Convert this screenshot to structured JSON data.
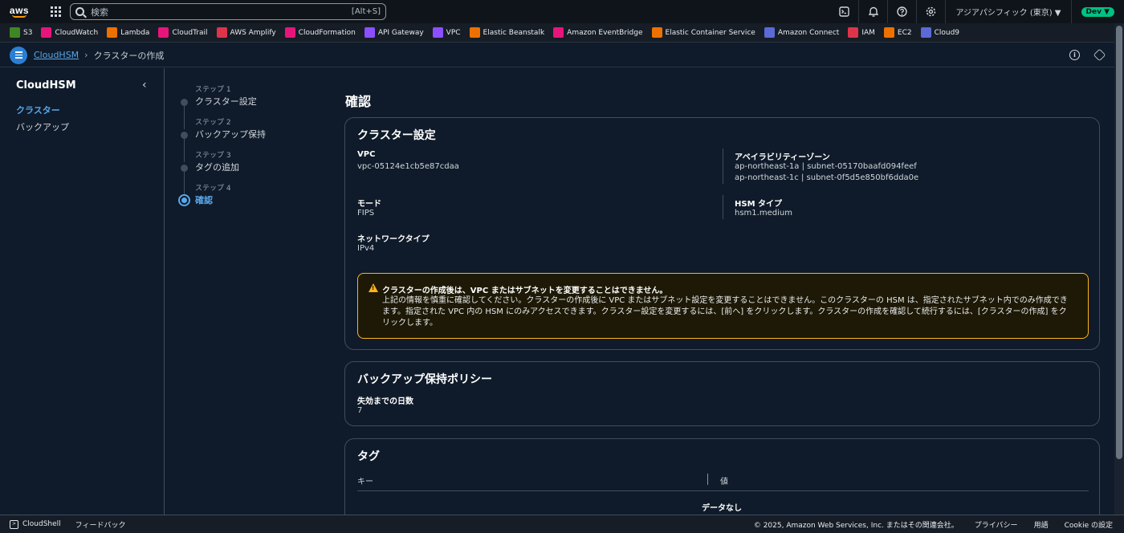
{
  "topnav": {
    "logo_text": "aws",
    "search_placeholder": "検索",
    "search_shortcut": "[Alt+S]",
    "region": "アジアパシフィック (東京) ▼",
    "account_badge": "Dev ▼"
  },
  "favorites": [
    {
      "label": "S3",
      "color": "#3f8624",
      "icon": "s3-icon"
    },
    {
      "label": "CloudWatch",
      "color": "#e7157b",
      "icon": "cloudwatch-icon"
    },
    {
      "label": "Lambda",
      "color": "#ed7100",
      "icon": "lambda-icon"
    },
    {
      "label": "CloudTrail",
      "color": "#e7157b",
      "icon": "cloudtrail-icon"
    },
    {
      "label": "AWS Amplify",
      "color": "#dd344c",
      "icon": "amplify-icon"
    },
    {
      "label": "CloudFormation",
      "color": "#e7157b",
      "icon": "cloudformation-icon"
    },
    {
      "label": "API Gateway",
      "color": "#8c4fff",
      "icon": "api-gateway-icon"
    },
    {
      "label": "VPC",
      "color": "#8c4fff",
      "icon": "vpc-icon"
    },
    {
      "label": "Elastic Beanstalk",
      "color": "#ed7100",
      "icon": "beanstalk-icon"
    },
    {
      "label": "Amazon EventBridge",
      "color": "#e7157b",
      "icon": "eventbridge-icon"
    },
    {
      "label": "Elastic Container Service",
      "color": "#ed7100",
      "icon": "ecs-icon"
    },
    {
      "label": "Amazon Connect",
      "color": "#5a6ad6",
      "icon": "connect-icon"
    },
    {
      "label": "IAM",
      "color": "#dd344c",
      "icon": "iam-icon"
    },
    {
      "label": "EC2",
      "color": "#ed7100",
      "icon": "ec2-icon"
    },
    {
      "label": "Cloud9",
      "color": "#5a6ad6",
      "icon": "cloud9-icon"
    }
  ],
  "breadcrumb": {
    "root": "CloudHSM",
    "current": "クラスターの作成"
  },
  "sidebar": {
    "title": "CloudHSM",
    "items": [
      {
        "label": "クラスター",
        "active": true
      },
      {
        "label": "バックアップ",
        "active": false
      }
    ]
  },
  "steps": [
    {
      "label": "ステップ 1",
      "name": "クラスター設定"
    },
    {
      "label": "ステップ 2",
      "name": "バックアップ保持"
    },
    {
      "label": "ステップ 3",
      "name": "タグの追加"
    },
    {
      "label": "ステップ 4",
      "name": "確認"
    }
  ],
  "page_title": "確認",
  "cluster": {
    "title": "クラスター設定",
    "vpc_key": "VPC",
    "vpc_value": "vpc-05124e1cb5e87cdaa",
    "az_key": "アベイラビリティーゾーン",
    "az_value_1": "ap-northeast-1a | subnet-05170baafd094feef",
    "az_value_2": "ap-northeast-1c | subnet-0f5d5e850bf6dda0e",
    "mode_key": "モード",
    "mode_value": "FIPS",
    "hsm_key": "HSM タイプ",
    "hsm_value": "hsm1.medium",
    "net_key": "ネットワークタイプ",
    "net_value": "IPv4",
    "alert_title": "クラスターの作成後は、VPC またはサブネットを変更することはできません。",
    "alert_body": "上記の情報を慎重に確認してください。クラスターの作成後に VPC またはサブネット設定を変更することはできません。このクラスターの HSM は、指定されたサブネット内でのみ作成できます。指定された VPC 内の HSM にのみアクセスできます。クラスター設定を変更するには、[前へ] をクリックします。クラスターの作成を確認して続行するには、[クラスターの作成] をクリックします。"
  },
  "backup": {
    "title": "バックアップ保持ポリシー",
    "days_key": "失効までの日数",
    "days_value": "7"
  },
  "tags": {
    "title": "タグ",
    "col_key": "キー",
    "col_value": "値",
    "empty": "データなし"
  },
  "footer": {
    "cloudshell": "CloudShell",
    "feedback": "フィードバック",
    "copyright": "© 2025, Amazon Web Services, Inc. またはその関連会社。",
    "privacy": "プライバシー",
    "terms": "用語",
    "cookies": "Cookie の設定"
  }
}
